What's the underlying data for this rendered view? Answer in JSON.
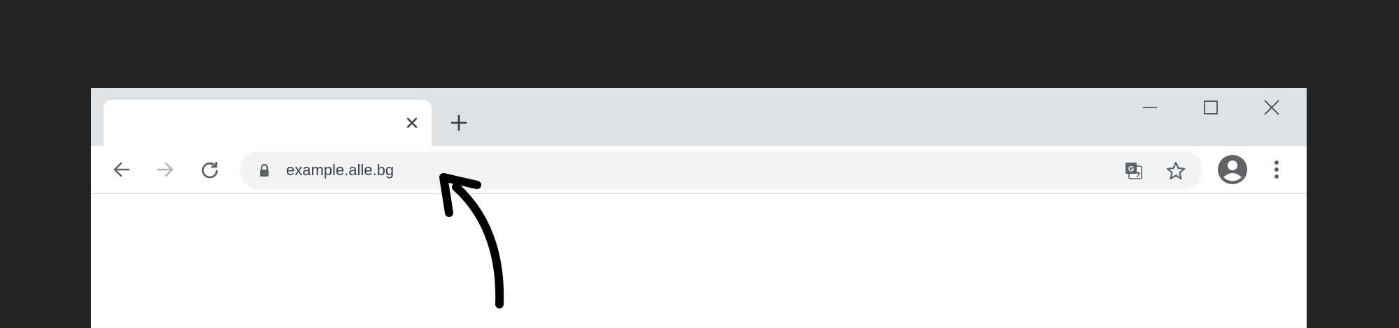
{
  "browser": {
    "tab": {
      "title": "",
      "close_icon": "close-icon"
    },
    "new_tab_icon": "plus-icon",
    "window_controls": [
      "minimize-icon",
      "maximize-icon",
      "close-icon"
    ],
    "toolbar": {
      "back_icon": "arrow-left-icon",
      "forward_icon": "arrow-right-icon",
      "reload_icon": "reload-icon",
      "omnibox": {
        "lock_icon": "lock-icon",
        "url": "example.alle.bg",
        "translate_icon": "translate-icon",
        "bookmark_icon": "star-icon"
      },
      "profile_icon": "account-circle-icon",
      "menu_icon": "more-vert-icon"
    }
  },
  "annotation": {
    "arrow_icon": "hand-drawn-arrow-icon",
    "color": "#000000"
  },
  "colors": {
    "background": "#232323",
    "tabstrip": "#dee1e6",
    "omnibox": "#f1f3f4",
    "icon": "#5f6368",
    "text": "#3c4043"
  }
}
